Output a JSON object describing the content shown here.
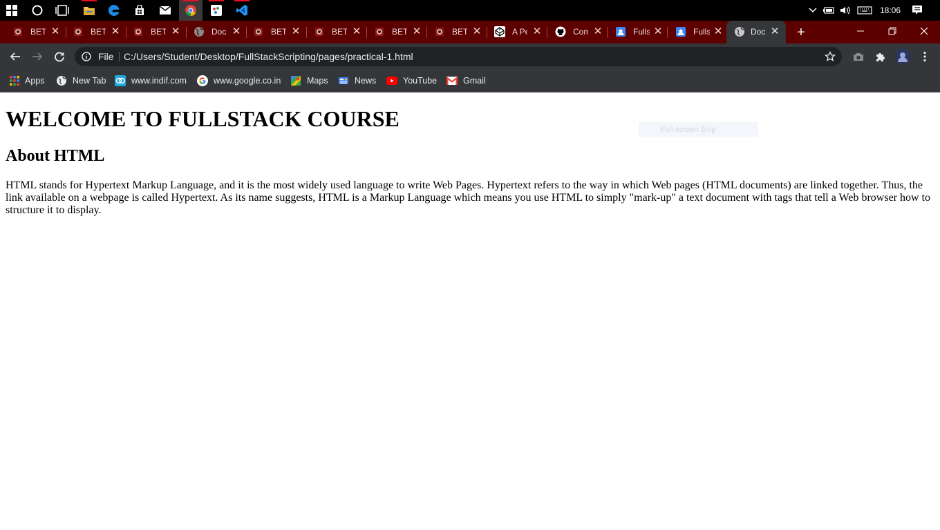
{
  "taskbar": {
    "apps": [
      "start-icon",
      "cortana-icon",
      "task-view-icon",
      "file-explorer-icon",
      "edge-icon",
      "store-icon",
      "mail-icon",
      "chrome-icon",
      "paint-icon",
      "vscode-icon"
    ],
    "clock": "18:06"
  },
  "tabs": [
    {
      "title": "BETA",
      "icon": "beta-icon"
    },
    {
      "title": "BETA",
      "icon": "beta-icon"
    },
    {
      "title": "BETA",
      "icon": "beta-icon"
    },
    {
      "title": "Doc",
      "icon": "globe-icon"
    },
    {
      "title": "BETA",
      "icon": "beta-icon"
    },
    {
      "title": "BETA",
      "icon": "beta-icon"
    },
    {
      "title": "BETA",
      "icon": "beta-icon"
    },
    {
      "title": "BETA",
      "icon": "beta-icon"
    },
    {
      "title": "A Pe",
      "icon": "codepen-icon"
    },
    {
      "title": "Com",
      "icon": "github-icon"
    },
    {
      "title": "Fulls",
      "icon": "classroom-icon"
    },
    {
      "title": "Fulls",
      "icon": "classroom-icon"
    },
    {
      "title": "Doc",
      "icon": "globe-icon",
      "active": true
    }
  ],
  "addressbar": {
    "scheme_label": "File",
    "url": "C:/Users/Student/Desktop/FullStackScripting/pages/practical-1.html"
  },
  "bookmarks": [
    {
      "label": "Apps",
      "icon": "apps-grid-icon"
    },
    {
      "label": "New Tab",
      "icon": "globe-icon"
    },
    {
      "label": "www.indif.com",
      "icon": "indif-icon"
    },
    {
      "label": "www.google.co.in",
      "icon": "google-icon"
    },
    {
      "label": "Maps",
      "icon": "maps-icon"
    },
    {
      "label": "News",
      "icon": "news-icon"
    },
    {
      "label": "YouTube",
      "icon": "youtube-icon"
    },
    {
      "label": "Gmail",
      "icon": "gmail-icon"
    }
  ],
  "page": {
    "heading": "WELCOME TO FULLSTACK COURSE",
    "subheading": "About HTML",
    "paragraph": "HTML stands for Hypertext Markup Language, and it is the most widely used language to write Web Pages. Hypertext refers to the way in which Web pages (HTML documents) are linked together. Thus, the link available on a webpage is called Hypertext. As its name suggests, HTML is a Markup Language which means you use HTML to simply \"mark-up\" a text document with tags that tell a Web browser how to structure it to display.",
    "snip_overlay": "Full-screen Snip"
  },
  "colors": {
    "tabstrip": "#5c0000",
    "toolbar": "#35363a",
    "omnibox": "#202124"
  }
}
